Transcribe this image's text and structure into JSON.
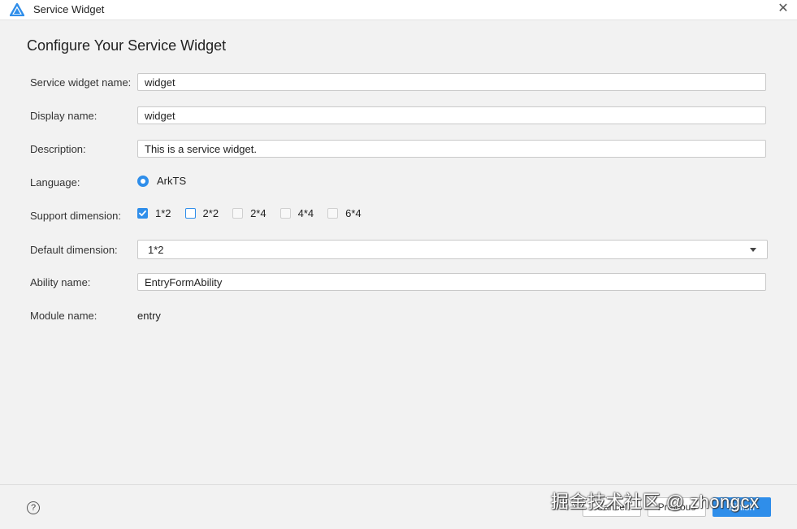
{
  "window": {
    "title": "Service Widget"
  },
  "heading": "Configure Your Service Widget",
  "form": {
    "service_widget_name": {
      "label": "Service widget name:",
      "value": "widget"
    },
    "display_name": {
      "label": "Display name:",
      "value": "widget"
    },
    "description": {
      "label": "Description:",
      "value": "This is a service widget."
    },
    "language": {
      "label": "Language:",
      "option": "ArkTS",
      "selected": true
    },
    "support_dimension": {
      "label": "Support dimension:",
      "options": [
        {
          "label": "1*2",
          "checked": true
        },
        {
          "label": "2*2",
          "checked": false,
          "focused": true
        },
        {
          "label": "2*4",
          "checked": false
        },
        {
          "label": "4*4",
          "checked": false
        },
        {
          "label": "6*4",
          "checked": false
        }
      ]
    },
    "default_dimension": {
      "label": "Default dimension:",
      "value": "1*2"
    },
    "ability_name": {
      "label": "Ability name:",
      "value": "EntryFormAbility"
    },
    "module_name": {
      "label": "Module name:",
      "value": "entry"
    }
  },
  "footer": {
    "help_icon": "help-icon",
    "cancel_label": "Cancel",
    "previous_label": "Previous",
    "finish_label": "Finish"
  },
  "watermark": "掘金技术社区 @ zhongcx",
  "colors": {
    "accent": "#2f8eea",
    "background": "#f2f2f2"
  }
}
